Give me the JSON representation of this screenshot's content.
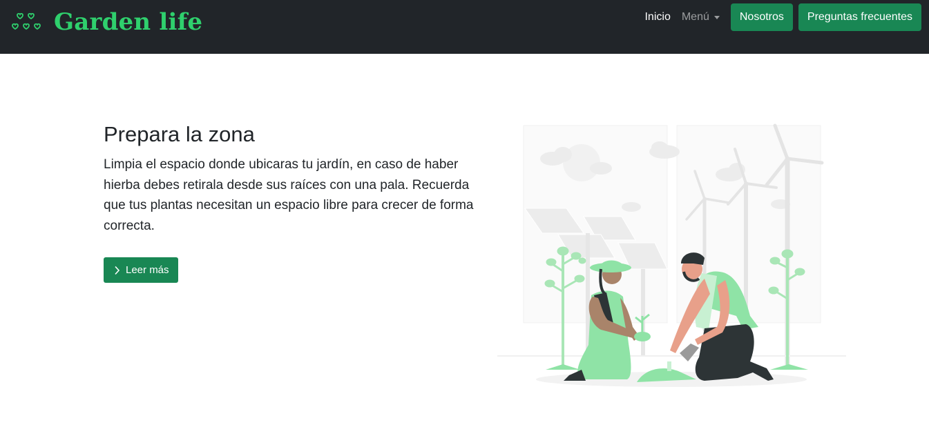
{
  "brand": {
    "name": "Garden life",
    "icon": "hearts-icon",
    "color": "#2fd06d"
  },
  "nav": {
    "home": "Inicio",
    "menu": "Menú",
    "about": "Nosotros",
    "faq": "Preguntas frecuentes"
  },
  "hero": {
    "title": "Prepara la zona",
    "text": "Limpia el espacio donde ubicaras tu jardín, en caso de haber hierba debes retirala desde sus raíces con una pala. Recuerda que tus plantas necesitan un espacio libre para crecer de forma correcta.",
    "cta": "Leer más",
    "cta_icon": "chevron-right-icon"
  },
  "illustration": {
    "subject": "gardening-illustration"
  },
  "colors": {
    "navbar": "#212529",
    "primary": "#198754",
    "accent": "#8fe3a6"
  }
}
